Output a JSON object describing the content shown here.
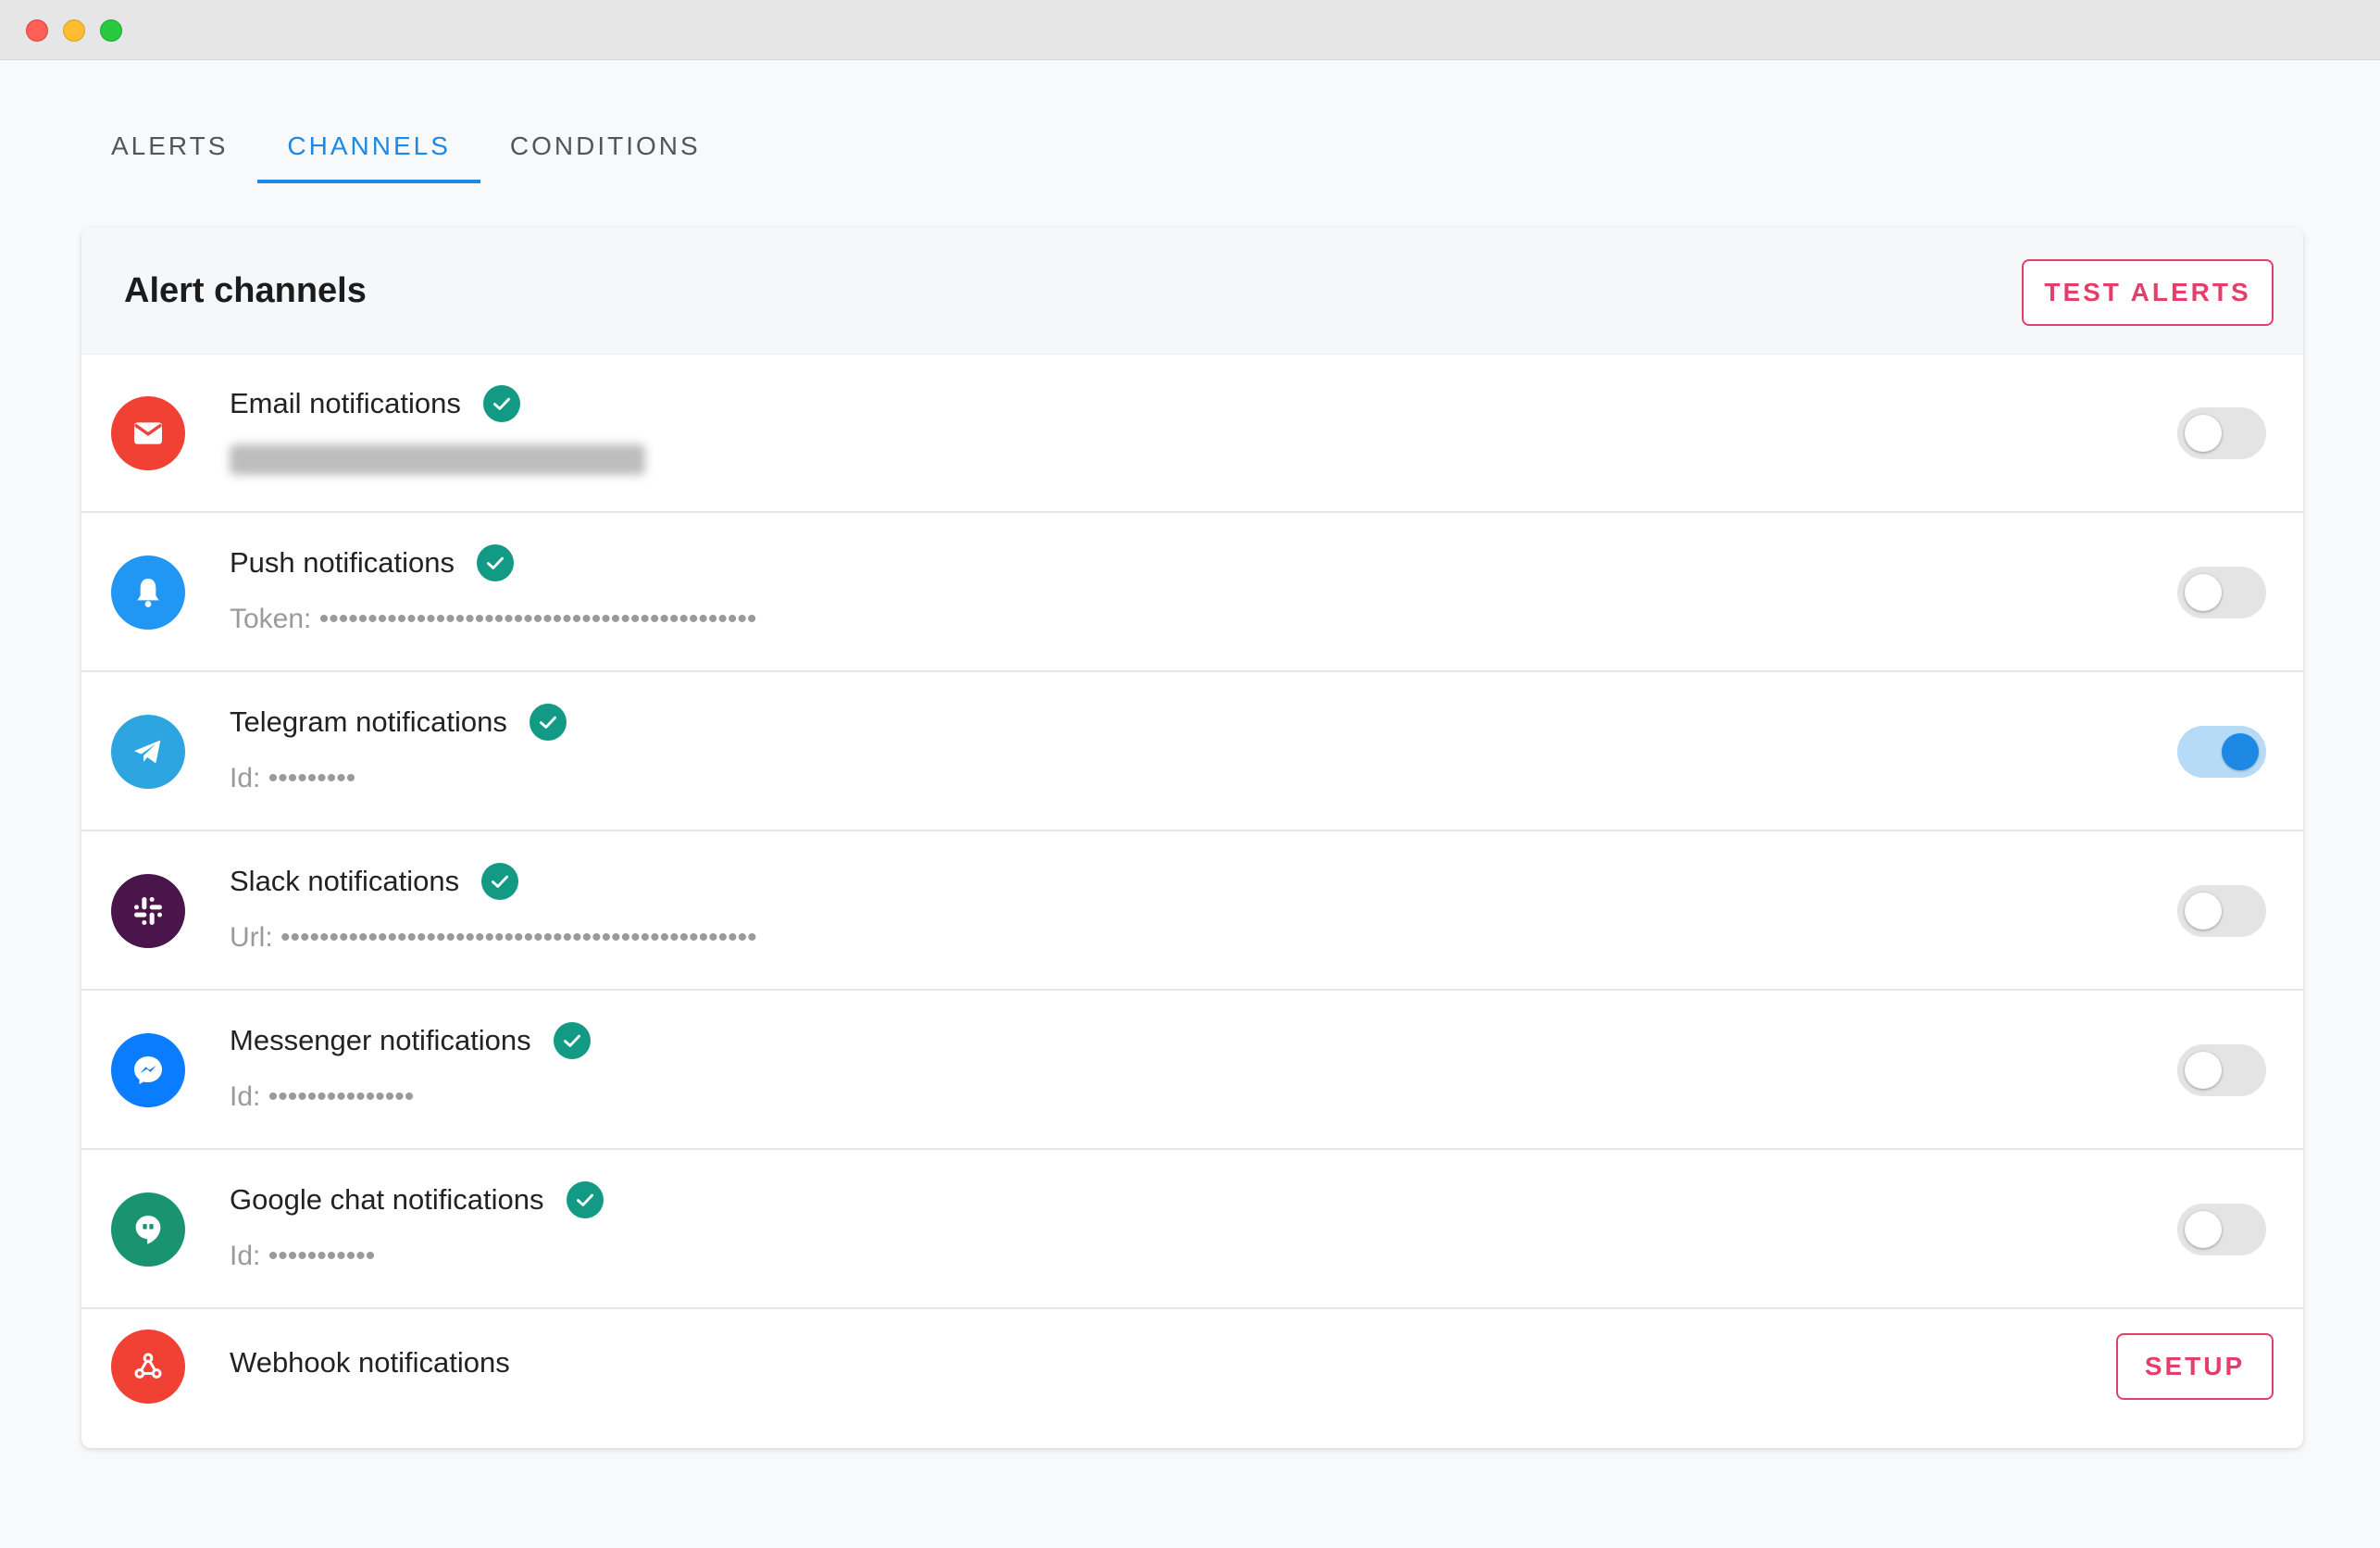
{
  "tabs": [
    {
      "label": "ALERTS",
      "active": false
    },
    {
      "label": "CHANNELS",
      "active": true
    },
    {
      "label": "CONDITIONS",
      "active": false
    }
  ],
  "card": {
    "title": "Alert channels",
    "test_button": "TEST ALERTS"
  },
  "channels": [
    {
      "name": "Email notifications",
      "value": "",
      "verified": true,
      "enabled": false,
      "icon": "mail-icon",
      "color": "#f04134"
    },
    {
      "name": "Push notifications",
      "value": "Token: •••••••••••••••••••••••••••••••••••••••••••••",
      "verified": true,
      "enabled": false,
      "icon": "bell-icon",
      "color": "#2196f3"
    },
    {
      "name": "Telegram notifications",
      "value": "Id: •••••••••",
      "verified": true,
      "enabled": true,
      "icon": "telegram-icon",
      "color": "#2ca5e0"
    },
    {
      "name": "Slack notifications",
      "value": "Url: •••••••••••••••••••••••••••••••••••••••••••••••••",
      "verified": true,
      "enabled": false,
      "icon": "slack-icon",
      "color": "#4a154b"
    },
    {
      "name": "Messenger notifications",
      "value": "Id: •••••••••••••••",
      "verified": true,
      "enabled": false,
      "icon": "messenger-icon",
      "color": "#0a7cff"
    },
    {
      "name": "Google chat notifications",
      "value": "Id: •••••••••••",
      "verified": true,
      "enabled": false,
      "icon": "google-chat-icon",
      "color": "#1a9470"
    }
  ],
  "webhook": {
    "name": "Webhook notifications",
    "setup_button": "SETUP",
    "icon": "webhook-icon",
    "color": "#f04134"
  },
  "colors": {
    "accent": "#1e88e5",
    "danger": "#e2406b",
    "verified": "#139a84"
  }
}
